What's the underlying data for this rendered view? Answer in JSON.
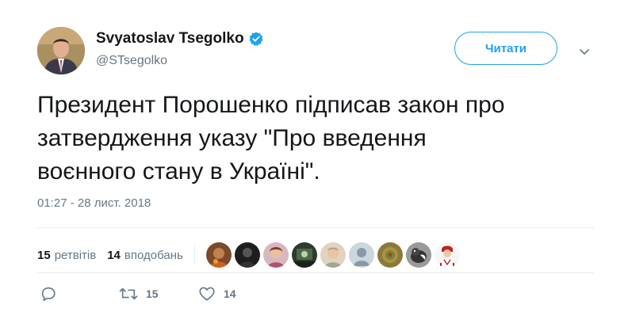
{
  "author": {
    "display_name": "Svyatoslav Tsegolko",
    "handle": "@STsegolko",
    "verified": true,
    "avatar_icon": "profile-photo-man-in-suit"
  },
  "follow_button": {
    "label": "Читати"
  },
  "tweet": {
    "text": "Президент Порошенко підписав закон про\nзатвердження указу \"Про введення\nвоєнного стану в Україні\".",
    "timestamp": "01:27 - 28 лист. 2018"
  },
  "stats": {
    "retweets_count": "15",
    "retweets_label": "ретвітів",
    "likes_count": "14",
    "likes_label": "вподобань"
  },
  "likers": [
    {
      "icon": "liker-avatar-1",
      "color": "#7a4a2a"
    },
    {
      "icon": "liker-avatar-2",
      "color": "#222222"
    },
    {
      "icon": "liker-avatar-3",
      "color": "#c9a0a8"
    },
    {
      "icon": "liker-avatar-4",
      "color": "#2e3a2e"
    },
    {
      "icon": "liker-avatar-5",
      "color": "#d8c8b0"
    },
    {
      "icon": "liker-avatar-6-default",
      "color": "#ccd6dd"
    },
    {
      "icon": "liker-avatar-7",
      "color": "#8a7a3a"
    },
    {
      "icon": "liker-avatar-8",
      "color": "#555555"
    },
    {
      "icon": "liker-avatar-9",
      "color": "#f2f2f2"
    }
  ],
  "actions": {
    "reply_icon": "reply-icon",
    "retweet_icon": "retweet-icon",
    "retweet_count": "15",
    "like_icon": "heart-icon",
    "like_count": "14"
  },
  "colors": {
    "accent": "#1da1f2",
    "text": "#14171a",
    "secondary": "#657786",
    "divider": "#e6ecf0"
  }
}
